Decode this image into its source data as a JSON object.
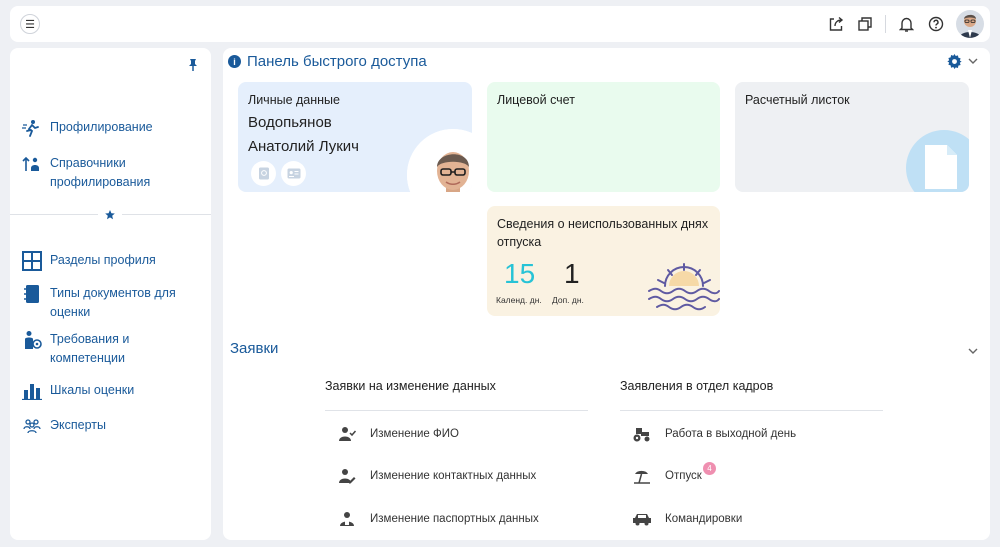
{
  "sidebar": {
    "items_top": [
      {
        "label": "Профилирование",
        "icon": "run-person-icon"
      },
      {
        "label": "Справочники профилирования",
        "icon": "sort-people-icon"
      }
    ],
    "items_bottom": [
      {
        "label": "Разделы профиля",
        "icon": "grid-icon"
      },
      {
        "label": "Типы документов для оценки",
        "icon": "notebook-icon"
      },
      {
        "label": "Требования и компетенции",
        "icon": "person-settings-icon"
      },
      {
        "label": "Шкалы оценки",
        "icon": "bar-chart-icon"
      },
      {
        "label": "Эксперты",
        "icon": "group-icon"
      }
    ]
  },
  "quick_access": {
    "title": "Панель быстрого доступа",
    "personal": {
      "title": "Личные данные",
      "name_line1": "Водопьянов",
      "name_line2": "Анатолий Лукич"
    },
    "account": {
      "title": "Лицевой счет"
    },
    "payslip": {
      "title": "Расчетный листок"
    },
    "vacation": {
      "title": "Сведения о неиспользованных днях отпуска",
      "calendar_days": "15",
      "calendar_caption": "Календ. дн.",
      "extra_days": "1",
      "extra_caption": "Доп. дн."
    }
  },
  "requests": {
    "title": "Заявки",
    "left": {
      "header": "Заявки на изменение данных",
      "items": [
        {
          "label": "Изменение ФИО",
          "icon": "person-check-icon"
        },
        {
          "label": "Изменение контактных данных",
          "icon": "person-edit-icon"
        },
        {
          "label": "Изменение паспортных данных",
          "icon": "person-id-icon"
        }
      ]
    },
    "right": {
      "header": "Заявления в отдел кадров",
      "items": [
        {
          "label": "Работа в выходной день",
          "icon": "tractor-icon"
        },
        {
          "label": "Отпуск",
          "icon": "beach-icon",
          "badge": "4"
        },
        {
          "label": "Командировки",
          "icon": "car-icon"
        }
      ]
    }
  },
  "colors": {
    "accent": "#1a5a9a",
    "cyan": "#27c3d6",
    "badge": "#ef8fb0"
  }
}
